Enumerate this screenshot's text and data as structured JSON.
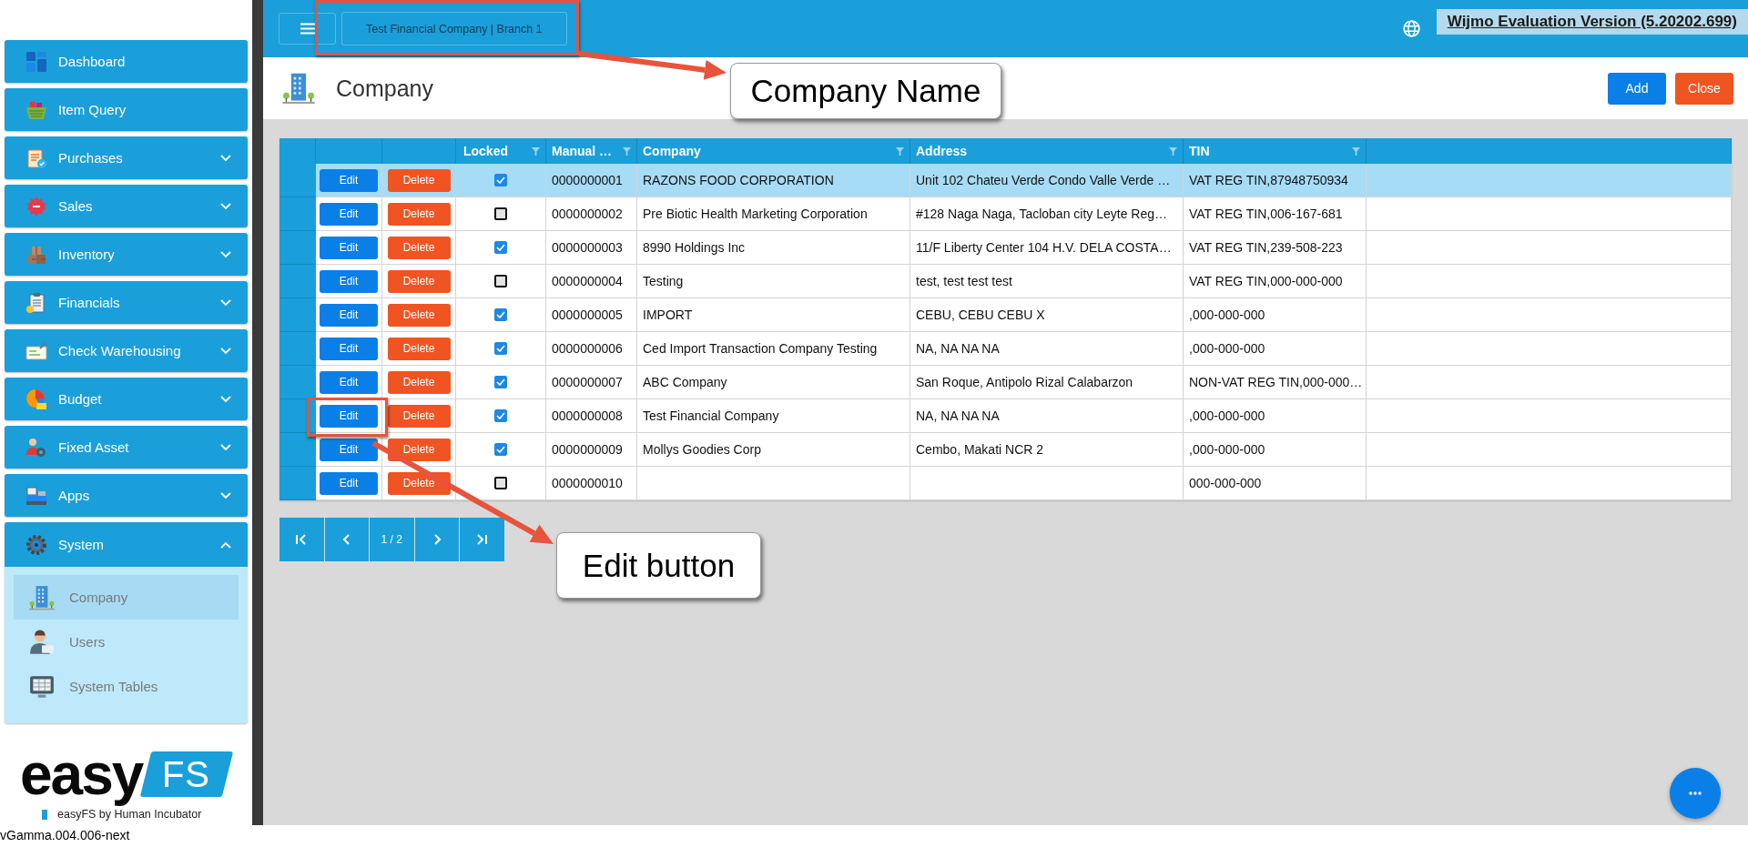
{
  "sidebar": {
    "items": [
      {
        "label": "Dashboard",
        "kind": "link"
      },
      {
        "label": "Item Query",
        "kind": "link"
      },
      {
        "label": "Purchases",
        "kind": "group",
        "expanded": false
      },
      {
        "label": "Sales",
        "kind": "group",
        "expanded": false
      },
      {
        "label": "Inventory",
        "kind": "group",
        "expanded": false
      },
      {
        "label": "Financials",
        "kind": "group",
        "expanded": false
      },
      {
        "label": "Check Warehousing",
        "kind": "group",
        "expanded": false
      },
      {
        "label": "Budget",
        "kind": "group",
        "expanded": false
      },
      {
        "label": "Fixed Asset",
        "kind": "group",
        "expanded": false
      },
      {
        "label": "Apps",
        "kind": "group",
        "expanded": false
      },
      {
        "label": "System",
        "kind": "group",
        "expanded": true,
        "children": [
          {
            "label": "Company",
            "selected": true
          },
          {
            "label": "Users",
            "selected": false
          },
          {
            "label": "System Tables",
            "selected": false
          }
        ]
      }
    ]
  },
  "logo": {
    "wordmark": "easy",
    "badge": "FS",
    "tagline": "easyFS by Human Incubator"
  },
  "version": "vGamma.004.006-next",
  "topbar": {
    "company_branch": "Test Financial Company | Branch 1",
    "evaluation_banner": "Wijmo Evaluation Version (5.20202.699)"
  },
  "page_header": {
    "title": "Company",
    "buttons": [
      {
        "label": "Add",
        "kind": "primary"
      },
      {
        "label": "Close",
        "kind": "danger"
      }
    ]
  },
  "table": {
    "columns": [
      "Locked",
      "Manual …",
      "Company",
      "Address",
      "TIN"
    ],
    "rows": [
      {
        "edit": "Edit",
        "delete": "Delete",
        "locked": true,
        "selected": true,
        "manual_no": "0000000001",
        "company": "RAZONS FOOD CORPORATION",
        "address": "Unit 102 Chateu Verde Condo Valle Verde …",
        "tin": "VAT REG TIN,87948750934"
      },
      {
        "edit": "Edit",
        "delete": "Delete",
        "locked": false,
        "selected": false,
        "manual_no": "0000000002",
        "company": "Pre Biotic Health Marketing Corporation",
        "address": "#128 Naga Naga, Tacloban city Leyte Reg…",
        "tin": "VAT REG TIN,006-167-681"
      },
      {
        "edit": "Edit",
        "delete": "Delete",
        "locked": true,
        "selected": false,
        "manual_no": "0000000003",
        "company": "8990 Holdings Inc",
        "address": "11/F Liberty Center 104 H.V. DELA COSTA…",
        "tin": "VAT REG TIN,239-508-223"
      },
      {
        "edit": "Edit",
        "delete": "Delete",
        "locked": false,
        "selected": false,
        "manual_no": "0000000004",
        "company": "Testing",
        "address": "test, test test test",
        "tin": "VAT REG TIN,000-000-000"
      },
      {
        "edit": "Edit",
        "delete": "Delete",
        "locked": true,
        "selected": false,
        "manual_no": "0000000005",
        "company": "IMPORT",
        "address": "CEBU, CEBU CEBU X",
        "tin": ",000-000-000"
      },
      {
        "edit": "Edit",
        "delete": "Delete",
        "locked": true,
        "selected": false,
        "manual_no": "0000000006",
        "company": "Ced Import Transaction Company Testing",
        "address": "NA, NA NA NA",
        "tin": ",000-000-000"
      },
      {
        "edit": "Edit",
        "delete": "Delete",
        "locked": true,
        "selected": false,
        "manual_no": "0000000007",
        "company": "ABC Company",
        "address": "San Roque, Antipolo Rizal Calabarzon",
        "tin": "NON-VAT REG TIN,000-000…"
      },
      {
        "edit": "Edit",
        "delete": "Delete",
        "locked": true,
        "selected": false,
        "manual_no": "0000000008",
        "company": "Test Financial Company",
        "address": "NA, NA NA NA",
        "tin": ",000-000-000"
      },
      {
        "edit": "Edit",
        "delete": "Delete",
        "locked": true,
        "selected": false,
        "manual_no": "0000000009",
        "company": "Mollys Goodies Corp",
        "address": "Cembo, Makati NCR 2",
        "tin": ",000-000-000"
      },
      {
        "edit": "Edit",
        "delete": "Delete",
        "locked": false,
        "selected": false,
        "manual_no": "0000000010",
        "tin": "000-000-000"
      }
    ]
  },
  "pager": {
    "page": "1 / 2"
  },
  "annotations": [
    {
      "text": "Company Name"
    },
    {
      "text": "Edit button"
    }
  ]
}
